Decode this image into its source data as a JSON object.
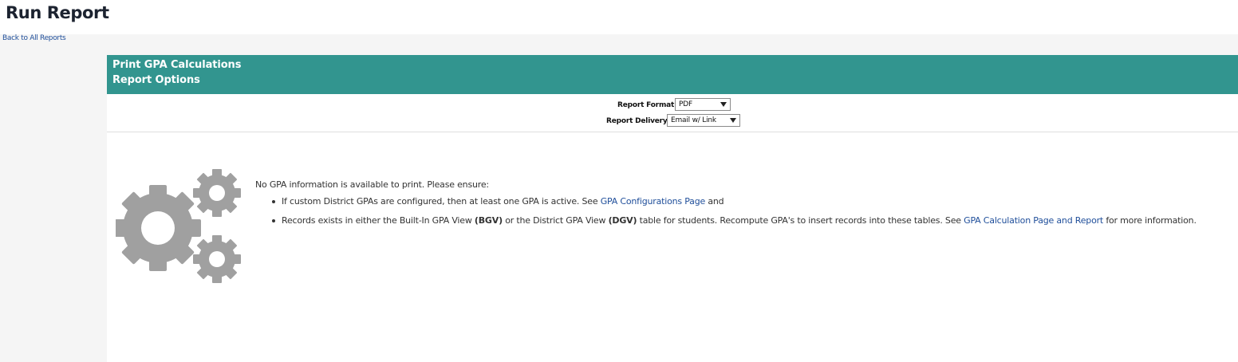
{
  "page": {
    "title": "Run Report",
    "back_link": "Back to All Reports"
  },
  "header": {
    "report_name": "Print GPA Calculations",
    "section": "Report Options"
  },
  "options": {
    "format_label": "Report Format:",
    "format_value": "PDF",
    "delivery_label": "Report Delivery:",
    "delivery_value": "Email w/ Link"
  },
  "message": {
    "intro": "No GPA information is available to print. Please ensure:",
    "bullet1": {
      "text_before": "If custom District GPAs are configured, then at least one GPA is active. See ",
      "link": "GPA Configurations Page",
      "text_after": " and"
    },
    "bullet2": {
      "text_1": "Records exists in either the Built-In GPA View ",
      "bold_1": "(BGV)",
      "text_2": " or the District GPA View ",
      "bold_2": "(DGV)",
      "text_3": " table for students. Recompute GPA's to insert records into these tables. See ",
      "link": "GPA Calculation Page and Report",
      "text_4": " for more information."
    }
  },
  "colors": {
    "header_bg": "#32958f",
    "link": "#1f4e9a",
    "gear": "#a0a0a0"
  },
  "icons": {
    "gears": "gears-icon",
    "dropdown": "chevron-down-icon"
  }
}
